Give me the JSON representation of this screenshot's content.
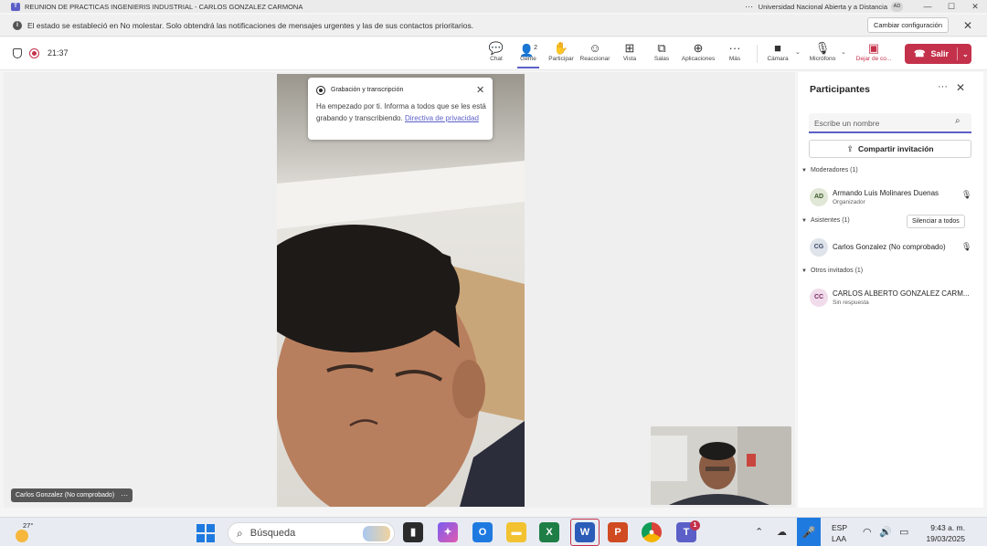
{
  "window": {
    "title": "REUNION DE PRACTICAS INGENIERIS INDUSTRIAL - CARLOS GONZALEZ CARMONA",
    "org": "Universidad Nacional Abierta y a Distancia",
    "user_initials": "AD"
  },
  "banner": {
    "message": "El estado se estableció en No molestar. Solo obtendrá las notificaciones de mensajes urgentes y las de sus contactos prioritarios.",
    "button_label": "Cambiar configuración"
  },
  "meeting": {
    "timer": "21:37",
    "participant_count": "2"
  },
  "toolbar": {
    "chat": "Chat",
    "people": "Gente",
    "raise": "Participar",
    "react": "Reaccionar",
    "view": "Vista",
    "rooms": "Salas",
    "apps": "Aplicaciones",
    "more": "Más",
    "camera": "Cámara",
    "mic": "Micrófono",
    "share": "Dejar de co...",
    "leave": "Salir"
  },
  "recording_popup": {
    "title": "Grabación y transcripción",
    "body": "Ha empezado por ti. Informa a todos que se les está grabando y transcribiendo.",
    "link": "Directiva de privacidad"
  },
  "stage": {
    "name_tag": "Carlos Gonzalez (No comprobado)"
  },
  "participants": {
    "heading": "Participantes",
    "search_placeholder": "Escribe un nombre",
    "share_invite": "Compartir invitación",
    "moderators_label": "Moderadores (1)",
    "attendees_label": "Asistentes (1)",
    "mute_all": "Silenciar a todos",
    "others_label": "Otros invitados (1)",
    "moderators": [
      {
        "initials": "AD",
        "name": "Armando Luis Molinares Duenas",
        "role": "Organizador"
      }
    ],
    "attendees": [
      {
        "initials": "CG",
        "name": "Carlos Gonzalez (No comprobado)"
      }
    ],
    "others": [
      {
        "initials": "CC",
        "name": "CARLOS ALBERTO GONZALEZ CARM...",
        "status": "Sin respuesta"
      }
    ]
  },
  "taskbar": {
    "temperature": "27°",
    "search": "Búsqueda",
    "teams_badge": "1",
    "lang_top": "ESP",
    "lang_bottom": "LAA",
    "time": "9:43 a. m.",
    "date": "19/03/2025"
  },
  "colors": {
    "accent": "#5b5fc7",
    "leave": "#c4314b"
  }
}
